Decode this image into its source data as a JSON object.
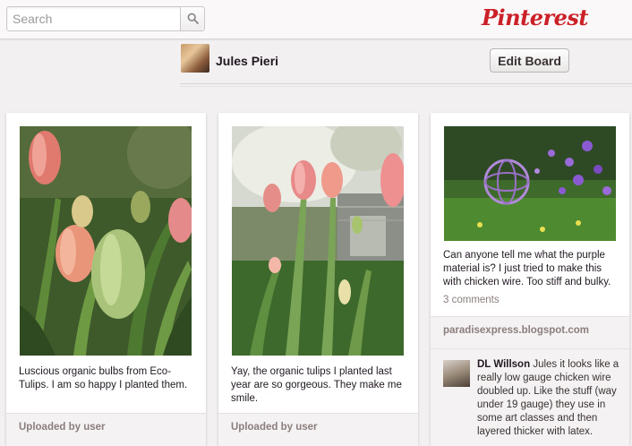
{
  "search": {
    "placeholder": "Search"
  },
  "brand": {
    "logo_text": "Pinterest",
    "color": "#cb2027"
  },
  "board": {
    "user_name": "Jules Pieri",
    "edit_label": "Edit Board"
  },
  "pins": [
    {
      "description": "Luscious organic bulbs from Eco-Tulips. I am so happy I planted them.",
      "footer": "Uploaded by user"
    },
    {
      "description": "Yay, the organic tulips I planted last year are so gorgeous. They make me smile.",
      "footer": "Uploaded by user"
    },
    {
      "description": "Can anyone tell me what the purple material is? I just tried to make this with chicken wire. Too stiff and bulky.",
      "comments": "3 comments",
      "source": "paradisexpress.blogspot.com",
      "comment": {
        "author": "DL Willson",
        "text": "Jules it looks like a really low gauge chicken wire doubled up. Like the stuff (way under 19 gauge) they use in some art classes and then layered thicker with latex."
      }
    }
  ]
}
